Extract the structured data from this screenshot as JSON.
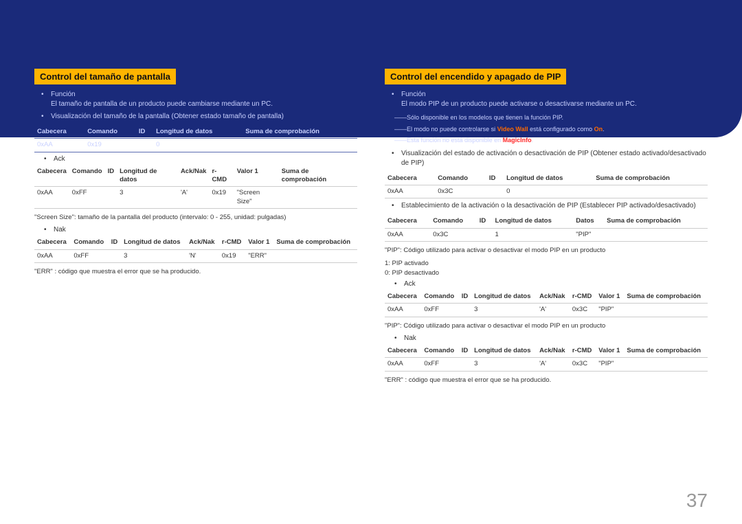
{
  "page_number": "37",
  "left": {
    "title": "Control del tamaño de pantalla",
    "func_label": "Función",
    "func_desc": "El tamaño de pantalla de un producto puede cambiarse mediante un PC.",
    "view_label": "Visualización del tamaño de la pantalla (Obtener estado tamaño de pantalla)",
    "t1": {
      "h": [
        "Cabecera",
        "Comando",
        "ID",
        "Longitud de datos",
        "Suma de comprobación"
      ],
      "r": [
        "0xAA",
        "0x19",
        "",
        "0",
        ""
      ]
    },
    "ack_label": "Ack",
    "t2": {
      "h": [
        "Cabecera",
        "Comando",
        "ID",
        "Longitud de datos",
        "Ack/Nak",
        "r-CMD",
        "Valor 1",
        "Suma de comprobación"
      ],
      "r": [
        "0xAA",
        "0xFF",
        "",
        "3",
        "'A'",
        "0x19",
        "\"Screen Size\"",
        ""
      ]
    },
    "screensize_desc": "\"Screen Size\": tamaño de la pantalla del producto (intervalo: 0 - 255, unidad: pulgadas)",
    "nak_label": "Nak",
    "t3": {
      "h": [
        "Cabecera",
        "Comando",
        "ID",
        "Longitud de datos",
        "Ack/Nak",
        "r-CMD",
        "Valor 1",
        "Suma de comprobación"
      ],
      "r": [
        "0xAA",
        "0xFF",
        "",
        "3",
        "'N'",
        "0x19",
        "\"ERR\"",
        ""
      ]
    },
    "err_desc": "\"ERR\" : código que muestra el error que se ha producido."
  },
  "right": {
    "title": "Control del encendido y apagado de PIP",
    "func_label": "Función",
    "func_desc": "El modo PIP de un producto puede activarse o desactivarse mediante un PC.",
    "note1": "――Sólo disponible en los modelos que tienen la función PIP.",
    "note2a": "――El modo no puede controlarse si ",
    "note2_vw": "Video Wall",
    "note2b": " está configurado como ",
    "note2_on": "On",
    "note2c": ".",
    "note3a": "――Esta función no está disponible en ",
    "note3_mi": "MagicInfo",
    "note3b": ".",
    "view_label": "Visualización del estado de activación o desactivación de PIP (Obtener estado activado/desactivado de PIP)",
    "t1": {
      "h": [
        "Cabecera",
        "Comando",
        "ID",
        "Longitud de datos",
        "Suma de comprobación"
      ],
      "r": [
        "0xAA",
        "0x3C",
        "",
        "0",
        ""
      ]
    },
    "set_label": "Establecimiento de la activación o la desactivación de PIP (Establecer PIP activado/desactivado)",
    "t2": {
      "h": [
        "Cabecera",
        "Comando",
        "ID",
        "Longitud de datos",
        "Datos",
        "Suma de comprobación"
      ],
      "r": [
        "0xAA",
        "0x3C",
        "",
        "1",
        "\"PIP\"",
        ""
      ]
    },
    "pip_desc": "\"PIP\": Código utilizado para activar o desactivar el modo PIP en un producto",
    "pip_on": "1: PIP activado",
    "pip_off": "0: PIP desactivado",
    "ack_label": "Ack",
    "t3": {
      "h": [
        "Cabecera",
        "Comando",
        "ID",
        "Longitud de datos",
        "Ack/Nak",
        "r-CMD",
        "Valor 1",
        "Suma de comprobación"
      ],
      "r": [
        "0xAA",
        "0xFF",
        "",
        "3",
        "'A'",
        "0x3C",
        "\"PIP\"",
        ""
      ]
    },
    "pip_desc2": "\"PIP\": Código utilizado para activar o desactivar el modo PIP en un producto",
    "nak_label": "Nak",
    "t4": {
      "h": [
        "Cabecera",
        "Comando",
        "ID",
        "Longitud de datos",
        "Ack/Nak",
        "r-CMD",
        "Valor 1",
        "Suma de comprobación"
      ],
      "r": [
        "0xAA",
        "0xFF",
        "",
        "3",
        "'A'",
        "0x3C",
        "\"PIP\"",
        ""
      ]
    },
    "err_desc": "\"ERR\" : código que muestra el error que se ha producido."
  }
}
